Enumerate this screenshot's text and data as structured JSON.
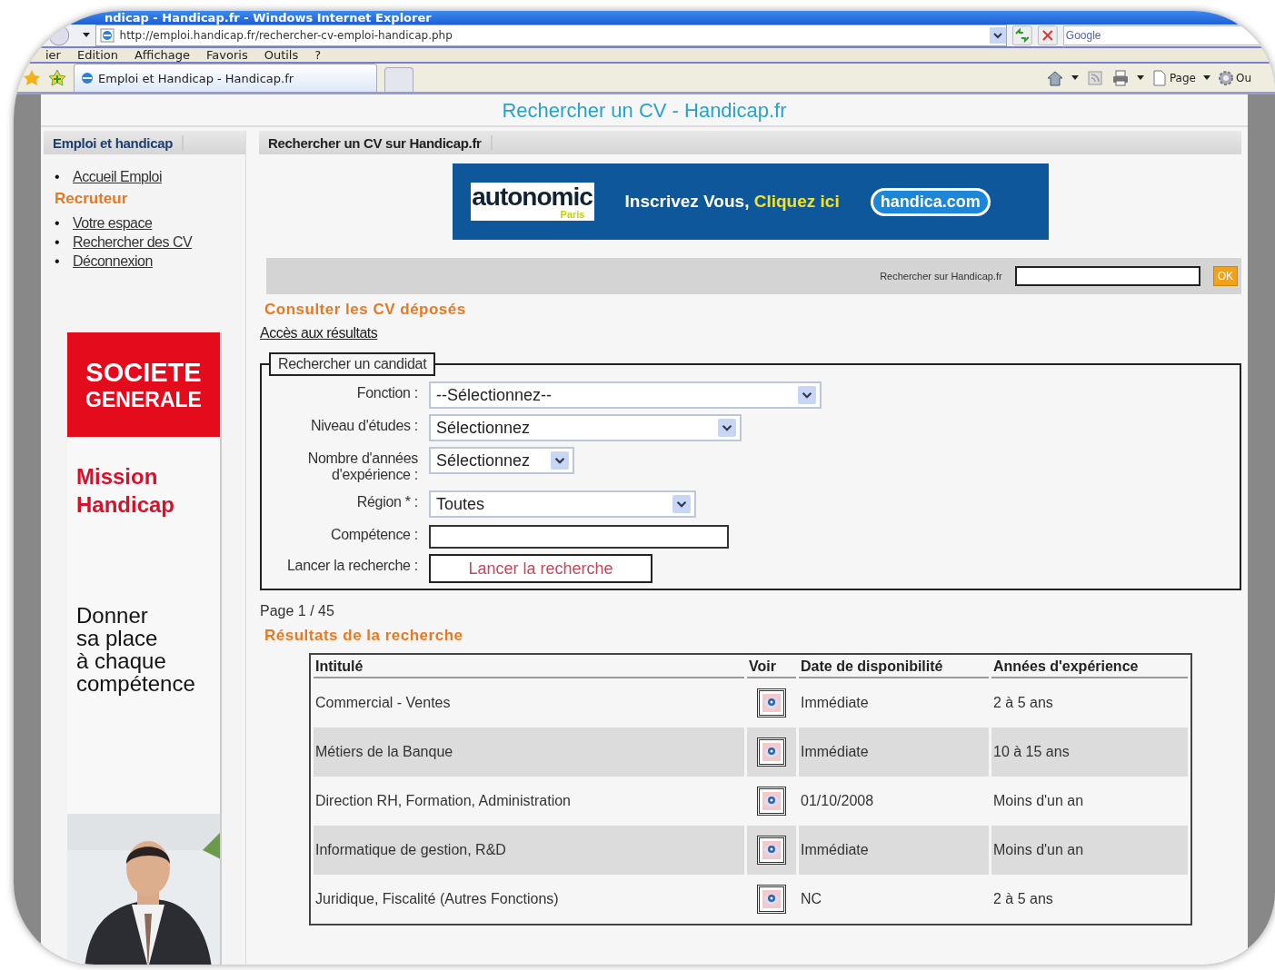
{
  "window": {
    "title": "ndicap - Handicap.fr - Windows Internet Explorer"
  },
  "address_bar": {
    "url": "http://emploi.handicap.fr/rechercher-cv-emploi-handicap.php",
    "search_placeholder": "Google"
  },
  "menu": [
    "ier",
    "Edition",
    "Affichage",
    "Favoris",
    "Outils",
    "?"
  ],
  "tabs": [
    {
      "label": "Emploi et Handicap - Handicap.fr",
      "selected": true
    }
  ],
  "command_bar": [
    "Page",
    "Ou"
  ],
  "page": {
    "title": "Rechercher un CV - Handicap.fr",
    "sidebar": {
      "header": "Emploi et handicap",
      "list_marker": "•",
      "links": [
        "Accueil Emploi"
      ],
      "section": "Recruteur",
      "section_links": [
        "Votre espace",
        "Rechercher des CV",
        "Déconnexion"
      ],
      "ad": {
        "brand_lines": [
          "SOCIETE",
          "GENERALE"
        ],
        "heading_lines": [
          "Mission",
          "Handicap"
        ],
        "slogan_lines": [
          "Donner",
          "sa place",
          "à chaque",
          "compétence"
        ],
        "photo": {
          "kind": "picture"
        }
      }
    },
    "main": {
      "header": "Rechercher un CV sur Handicap.fr",
      "banner": {
        "brand": "autonomic",
        "brand_sub": "Paris",
        "text": "Inscrivez Vous,",
        "highlight": "Cliquez ici",
        "partner": "handica.com"
      },
      "site_search": {
        "label": "Rechercher sur Handicap.fr",
        "button": "OK"
      },
      "section_title": "Consulter les CV déposés",
      "results_link": "Accès aux résultats",
      "form": {
        "legend": "Rechercher un candidat",
        "fields": [
          {
            "kind": "select",
            "label": "Fonction :",
            "value": "--Sélectionnez--"
          },
          {
            "kind": "select",
            "label": "Niveau d'études :",
            "value": "Sélectionnez"
          },
          {
            "kind": "select",
            "label": "Nombre d'années d'expérience :",
            "value": "Sélectionnez"
          },
          {
            "kind": "select",
            "label": "Région * :",
            "value": "Toutes"
          },
          {
            "kind": "text",
            "label": "Compétence :"
          },
          {
            "kind": "button",
            "label": "Lancer la recherche :",
            "value": "Lancer la recherche"
          }
        ]
      },
      "pagination": "Page 1 / 45",
      "results_title": "Résultats de la recherche",
      "table": {
        "columns": [
          "Intitulé",
          "Voir",
          "Date de disponibilité",
          "Années d'expérience"
        ],
        "rows": [
          {
            "title": "Commercial - Ventes",
            "date": "Immédiate",
            "experience": "2 à 5 ans"
          },
          {
            "title": "Métiers de la Banque",
            "date": "Immédiate",
            "experience": "10 à 15 ans"
          },
          {
            "title": "Direction RH, Formation, Administration",
            "date": "01/10/2008",
            "experience": "Moins d'un an"
          },
          {
            "title": "Informatique de gestion, R&D",
            "date": "Immédiate",
            "experience": "Moins d'un an"
          },
          {
            "title": "Juridique, Fiscalité (Autres Fonctions)",
            "date": "NC",
            "experience": "2 à 5 ans"
          }
        ]
      }
    }
  }
}
